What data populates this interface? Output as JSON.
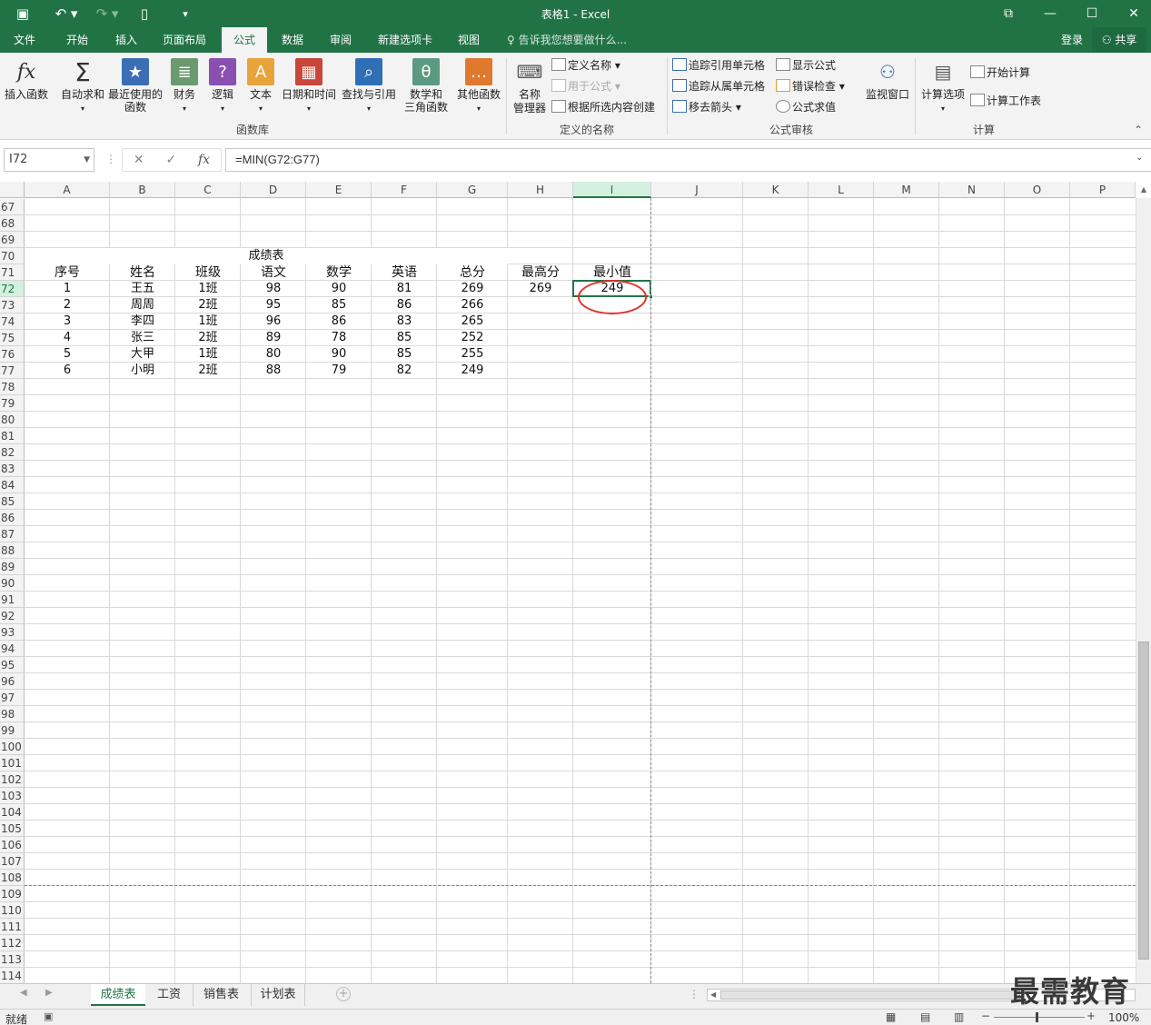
{
  "window": {
    "title": "表格1 - Excel"
  },
  "ribbon_tabs": [
    "文件",
    "开始",
    "插入",
    "页面布局",
    "公式",
    "数据",
    "审阅",
    "新建选项卡",
    "视图"
  ],
  "active_tab": "公式",
  "tell_me": "告诉我您想要做什么...",
  "account": {
    "signin": "登录",
    "share": "共享"
  },
  "function_library": {
    "group_label": "函数库",
    "buttons": [
      "插入函数",
      "自动求和",
      "最近使用的\n函数",
      "财务",
      "逻辑",
      "文本",
      "日期和时间",
      "查找与引用",
      "数学和\n三角函数",
      "其他函数"
    ]
  },
  "defined_names": {
    "group_label": "定义的名称",
    "big": "名称\n管理器",
    "define": "定义名称",
    "use": "用于公式",
    "create": "根据所选内容创建"
  },
  "formula_auditing": {
    "group_label": "公式审核",
    "trace_prec": "追踪引用单元格",
    "trace_dep": "追踪从属单元格",
    "remove_arrows": "移去箭头",
    "show_formulas": "显示公式",
    "error_check": "错误检查",
    "evaluate": "公式求值",
    "watch": "监视窗口"
  },
  "calculation": {
    "group_label": "计算",
    "options": "计算选项",
    "calc_now": "开始计算",
    "calc_sheet": "计算工作表"
  },
  "formula_bar": {
    "name_box": "I72",
    "formula": "=MIN(G72:G77)"
  },
  "columns": [
    "A",
    "B",
    "C",
    "D",
    "E",
    "F",
    "G",
    "H",
    "I",
    "J",
    "K",
    "L",
    "M",
    "N",
    "O",
    "P"
  ],
  "rows": [
    "67",
    "68",
    "69",
    "70",
    "71",
    "72",
    "73",
    "74",
    "75",
    "76",
    "77",
    "78",
    "79",
    "80",
    "81",
    "82",
    "83",
    "84",
    "85",
    "86",
    "87",
    "88",
    "89",
    "90",
    "91",
    "92",
    "93",
    "94",
    "95",
    "96",
    "97",
    "98",
    "99",
    "100",
    "101",
    "102",
    "103",
    "104",
    "105",
    "106",
    "107",
    "108",
    "109",
    "110",
    "111",
    "112",
    "113",
    "114"
  ],
  "selected_cell": "I72",
  "table": {
    "title": "成绩表",
    "headers": [
      "序号",
      "姓名",
      "班级",
      "语文",
      "数学",
      "英语",
      "总分",
      "最高分",
      "最小值"
    ],
    "records": [
      [
        "1",
        "王五",
        "1班",
        "98",
        "90",
        "81",
        "269"
      ],
      [
        "2",
        "周周",
        "2班",
        "95",
        "85",
        "86",
        "266"
      ],
      [
        "3",
        "李四",
        "1班",
        "96",
        "86",
        "83",
        "265"
      ],
      [
        "4",
        "张三",
        "2班",
        "89",
        "78",
        "85",
        "252"
      ],
      [
        "5",
        "大甲",
        "1班",
        "80",
        "90",
        "85",
        "255"
      ],
      [
        "6",
        "小明",
        "2班",
        "88",
        "79",
        "82",
        "249"
      ]
    ],
    "max_value": "269",
    "min_value": "249"
  },
  "sheet_tabs": [
    "成绩表",
    "工资",
    "销售表",
    "计划表"
  ],
  "active_sheet": "成绩表",
  "status": {
    "ready": "就绪",
    "zoom": "100%"
  },
  "watermark": "最需教育"
}
